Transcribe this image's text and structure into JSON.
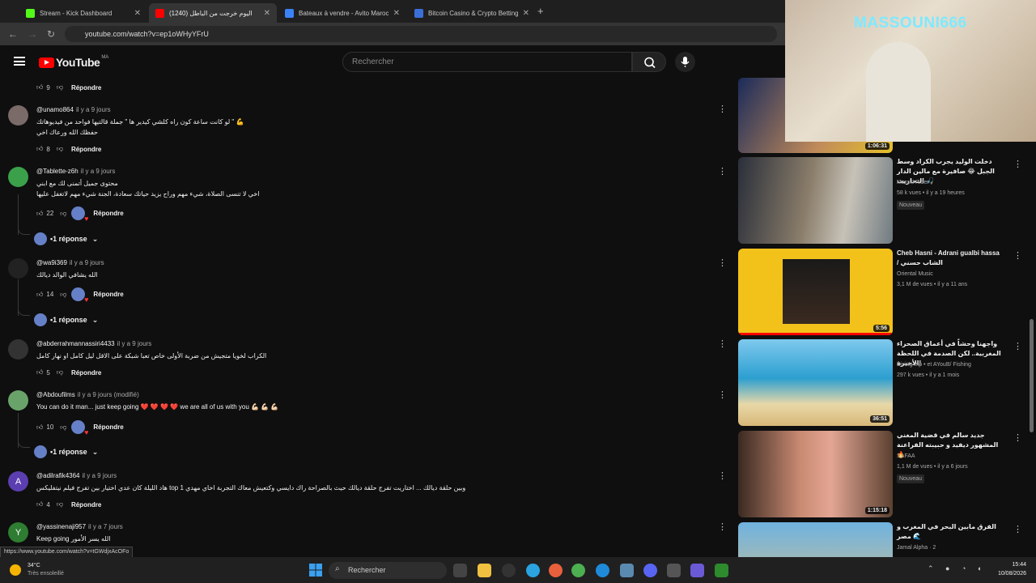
{
  "browser": {
    "tabs": [
      {
        "title": "Stream - Kick Dashboard",
        "fav": "#53fc18",
        "active": false
      },
      {
        "title": "(1240) اليوم خرجت من الباطل",
        "fav": "#ff0000",
        "active": true
      },
      {
        "title": "Bateaux à vendre - Avito Maroc",
        "fav": "#3b82f6",
        "active": false
      },
      {
        "title": "Bitcoin Casino & Crypto Betting",
        "fav": "#3a6fd8",
        "active": false
      }
    ],
    "url": "youtube.com/watch?v=ep1oWHyYFrU"
  },
  "youtube": {
    "logo": "YouTube",
    "country": "MA",
    "search_placeholder": "Rechercher"
  },
  "comments": [
    {
      "author": "",
      "time": "",
      "text": "",
      "likes": "9",
      "reply_label": "Répondre",
      "avatar_letter": "",
      "avatar_color": "",
      "hearted": false,
      "lines": []
    },
    {
      "author": "@unamo864",
      "time": "il y a 9 jours",
      "lines": [
        "لو كانت ساعة كون راه كلشي كيدير ها \" جملة قالتيها فواحد من فيديوهاتك \" 💪",
        "حفظك الله ورعاك اخي"
      ],
      "likes": "8",
      "reply_label": "Répondre",
      "avatar_letter": "",
      "avatar_color": "#7a6a68",
      "hearted": false
    },
    {
      "author": "@Tablette-z6h",
      "time": "il y a 9 jours",
      "lines": [
        "محتوى جميل أتمنى لك مع ابني",
        "اخي لا تنسى الصلاة، شيء مهم وراح يزيد حياتك سعادة، الجنة شيء مهم لاتغفل عليها"
      ],
      "likes": "22",
      "reply_label": "Répondre",
      "avatar_letter": "",
      "avatar_color": "#3aa14a",
      "hearted": true,
      "replies": "1 réponse"
    },
    {
      "author": "@wa9i369",
      "time": "il y a 9 jours",
      "lines": [
        "الله يشافي الوالد ديالك"
      ],
      "likes": "14",
      "reply_label": "Répondre",
      "avatar_letter": "",
      "avatar_color": "#222",
      "hearted": true,
      "replies": "1 réponse"
    },
    {
      "author": "@abderrahmannassiri4433",
      "time": "il y a 9 jours",
      "lines": [
        "الكراب لخويا متجيش من ضربة الأولى خاص تعبا شبكة على الاقل ليل كامل او نهار كامل"
      ],
      "likes": "5",
      "reply_label": "Répondre",
      "avatar_letter": "",
      "avatar_color": "#333",
      "hearted": false
    },
    {
      "author": "@Abdoufilms",
      "time": "il y a 9 jours (modifié)",
      "lines": [
        "You can do it man... just keep going ❤️ ❤️ ❤️ ❤️  we are all of us with you 💪🏻 💪🏻 💪🏻"
      ],
      "likes": "10",
      "reply_label": "Répondre",
      "avatar_letter": "",
      "avatar_color": "#6aa36a",
      "hearted": true,
      "replies": "1 réponse"
    },
    {
      "author": "@adilrafik4364",
      "time": "il y a 9 jours",
      "lines": [
        "هاد الليلة كان عدي اختيار بين تفرج فيلم نيتفليكس top 1 وبين حلقة ديالك ... اختاريت تفرج حلقة ديالك حيث بالصراحة راك دايسي وكتعيش معاك التجربة اخاي مهدي"
      ],
      "likes": "4",
      "reply_label": "Répondre",
      "avatar_letter": "A",
      "avatar_color": "#5b3fb0",
      "hearted": false
    },
    {
      "author": "@yassinenaji957",
      "time": "il y a 7 jours",
      "lines": [
        "Keep going الله يسر الأمور"
      ],
      "likes": "",
      "reply_label": "",
      "avatar_letter": "Y",
      "avatar_color": "#2e7d32",
      "hearted": false
    }
  ],
  "videos": [
    {
      "title": "",
      "duration": "1:06:31",
      "channel": "",
      "meta": "",
      "badge": ""
    },
    {
      "title": "دخلت الوليد يجرب الكراد وسط الجبل 😂 صافيرة مع مالين الدار التحاريت 🎣",
      "duration": "",
      "channel": "Maroki Rider",
      "meta": "58 k vues • il y a 19 heures",
      "badge": "Nouveau"
    },
    {
      "title": "Cheb Hasni - Adrani gualbi hassa / الشاب حسني",
      "duration": "5:56",
      "channel": "Oriental Music",
      "meta": "3,1 M de vues • il y a 11 ans",
      "badge": ""
    },
    {
      "title": "واجهنا وحشاً في أعماق الصحراء المغربية.. لكن الصدمة في اللحظة الأخيرة!",
      "duration": "36:51",
      "channel": "Diving trip • et AYouB/ Fishing",
      "meta": "297 k vues • il y a 1 mois",
      "badge": ""
    },
    {
      "title": "جديد سالم في قضية المغني المشهور ديفيد و حبيبته الفراعنة 🔥",
      "duration": "1:15:18",
      "channel": "SAFAA",
      "meta": "1,1 M de vues • il y a 6 jours",
      "badge": "Nouveau"
    },
    {
      "title": "الفرق مابين البحر في المغرب و مصر 🌊",
      "duration": "",
      "channel": "Jamal Alpha · 2",
      "meta": "",
      "badge": ""
    }
  ],
  "overlay": {
    "streamer": "MASSOUNI666"
  },
  "status_url": "https://www.youtube.com/watch?v=tGWdjxAcOFo",
  "taskbar": {
    "temp": "34°C",
    "weather": "Très ensoleillé",
    "search": "Rechercher",
    "time": "15:44",
    "date": "10/08/2026"
  }
}
